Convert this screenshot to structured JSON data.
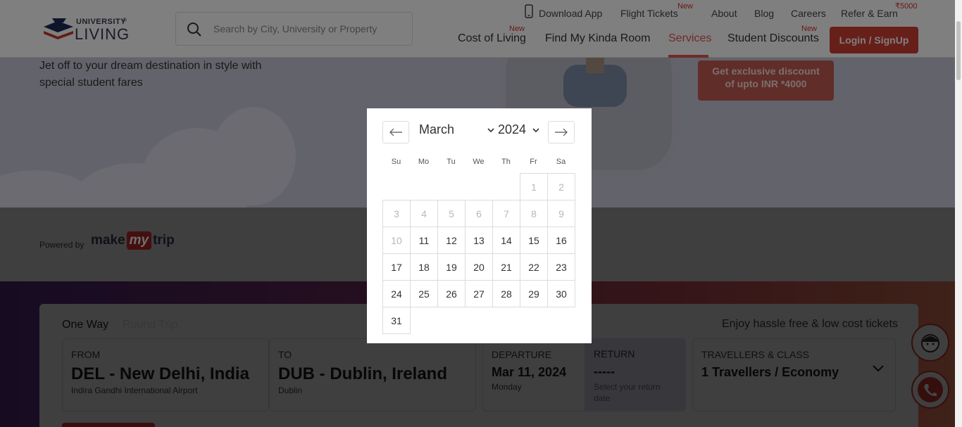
{
  "header": {
    "logo_top": "UNIVERSITY",
    "logo_main": "LIVING",
    "logo_mark": "®",
    "search_placeholder": "Search by City, University or Property",
    "top_links": {
      "download_app": "Download App",
      "flight_tickets": "Flight Tickets",
      "flight_tickets_badge": "New",
      "about": "About",
      "blog": "Blog",
      "careers": "Careers",
      "refer_earn": "Refer & Earn",
      "refer_earn_badge": "₹5000"
    },
    "main_nav": {
      "cost_of_living": "Cost of Living",
      "cost_of_living_badge": "New",
      "find_room": "Find My Kinda Room",
      "services": "Services",
      "student_discounts": "Student Discounts",
      "student_discounts_badge": "New"
    },
    "login_label": "Login / SignUp"
  },
  "hero": {
    "text_line1": "Jet off to your dream destination in style with",
    "text_line2": "special student fares",
    "promo_line1": "Get exclusive discount",
    "promo_line2": "of upto INR *4000"
  },
  "powered": {
    "label": "Powered by",
    "brand_a": "make",
    "brand_b": "my",
    "brand_c": "trip"
  },
  "booking": {
    "tab_oneway": "One Way",
    "tab_roundtrip": "Round Trip",
    "tagline": "Enjoy hassle free & low cost tickets",
    "from_label": "FROM",
    "from_value": "DEL - New Delhi, India",
    "from_sub": "Indira Gandhi International Airport",
    "to_label": "TO",
    "to_value": "DUB - Dublin, Ireland",
    "to_sub": "Dublin",
    "departure_label": "DEPARTURE",
    "departure_value": "Mar 11, 2024",
    "departure_sub": "Monday",
    "return_label": "RETURN",
    "return_value": "-----",
    "return_sub_1": "Select your return",
    "return_sub_2": "date",
    "travellers_label": "TRAVELLERS & CLASS",
    "travellers_value": "1 Travellers / Economy"
  },
  "datepicker": {
    "month": "March",
    "year": "2024",
    "weekdays": [
      "Su",
      "Mo",
      "Tu",
      "We",
      "Th",
      "Fr",
      "Sa"
    ],
    "days": [
      {
        "d": "1",
        "disabled": true
      },
      {
        "d": "2",
        "disabled": true
      },
      {
        "d": "3",
        "disabled": true
      },
      {
        "d": "4",
        "disabled": true
      },
      {
        "d": "5",
        "disabled": true
      },
      {
        "d": "6",
        "disabled": true
      },
      {
        "d": "7",
        "disabled": true
      },
      {
        "d": "8",
        "disabled": true
      },
      {
        "d": "9",
        "disabled": true
      },
      {
        "d": "10",
        "disabled": true
      },
      {
        "d": "11",
        "disabled": false
      },
      {
        "d": "12",
        "disabled": false
      },
      {
        "d": "13",
        "disabled": false
      },
      {
        "d": "14",
        "disabled": false
      },
      {
        "d": "15",
        "disabled": false
      },
      {
        "d": "16",
        "disabled": false
      },
      {
        "d": "17",
        "disabled": false
      },
      {
        "d": "18",
        "disabled": false
      },
      {
        "d": "19",
        "disabled": false
      },
      {
        "d": "20",
        "disabled": false
      },
      {
        "d": "21",
        "disabled": false
      },
      {
        "d": "22",
        "disabled": false
      },
      {
        "d": "23",
        "disabled": false
      },
      {
        "d": "24",
        "disabled": false
      },
      {
        "d": "25",
        "disabled": false
      },
      {
        "d": "26",
        "disabled": false
      },
      {
        "d": "27",
        "disabled": false
      },
      {
        "d": "28",
        "disabled": false
      },
      {
        "d": "29",
        "disabled": false
      },
      {
        "d": "30",
        "disabled": false
      },
      {
        "d": "31",
        "disabled": false
      }
    ],
    "first_weekday_index": 5,
    "prev_icon": "arrow-left-icon",
    "next_icon": "arrow-right-icon"
  },
  "colors": {
    "accent": "#e0574c",
    "login_bg": "#cf3f34",
    "new_badge": "#d6302d"
  }
}
